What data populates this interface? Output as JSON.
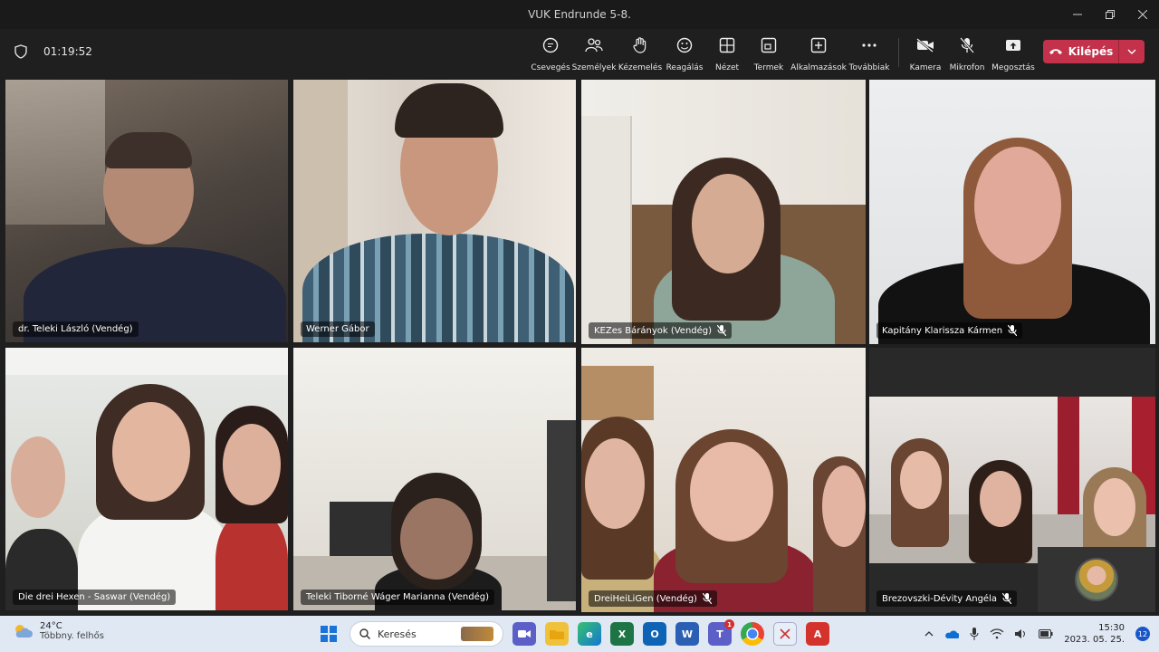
{
  "window": {
    "title": "VUK Endrunde 5-8."
  },
  "toolbar": {
    "timer": "01:19:52",
    "buttons": {
      "chat": "Csevegés",
      "people": "Személyek",
      "raise_hand": "Kézemelés",
      "react": "Reagálás",
      "view": "Nézet",
      "rooms": "Termek",
      "apps": "Alkalmazások",
      "more": "Továbbiak",
      "camera": "Kamera",
      "mic": "Mikrofon",
      "share": "Megosztás"
    },
    "leave_label": "Kilépés"
  },
  "participants": [
    {
      "name": "dr. Teleki László (Vendég)",
      "muted": false,
      "speaking": true
    },
    {
      "name": "Werner Gábor",
      "muted": false,
      "speaking": true
    },
    {
      "name": "KEZes Bárányok (Vendég)",
      "muted": true,
      "speaking": false
    },
    {
      "name": "Kapitány Klarissza Kármen",
      "muted": true,
      "speaking": false
    },
    {
      "name": "Die drei Hexen - Saswar (Vendég)",
      "muted": false,
      "speaking": true
    },
    {
      "name": "Teleki Tiborné Wáger Marianna (Vendég)",
      "muted": false,
      "speaking": true
    },
    {
      "name": "DreiHeiLiGen (Vendég)",
      "muted": true,
      "speaking": false
    },
    {
      "name": "Brezovszki-Dévity Angéla",
      "muted": true,
      "speaking": false
    }
  ],
  "taskbar": {
    "weather": {
      "temp": "24°C",
      "desc": "Többny. felhős"
    },
    "search_placeholder": "Keresés",
    "teams_badge": "1",
    "time": "15:30",
    "date": "2023. 05. 25.",
    "notif_count": "12"
  },
  "colors": {
    "accent": "#7f85f5",
    "leave": "#c4314b",
    "taskbar": "#dfe8f3"
  }
}
